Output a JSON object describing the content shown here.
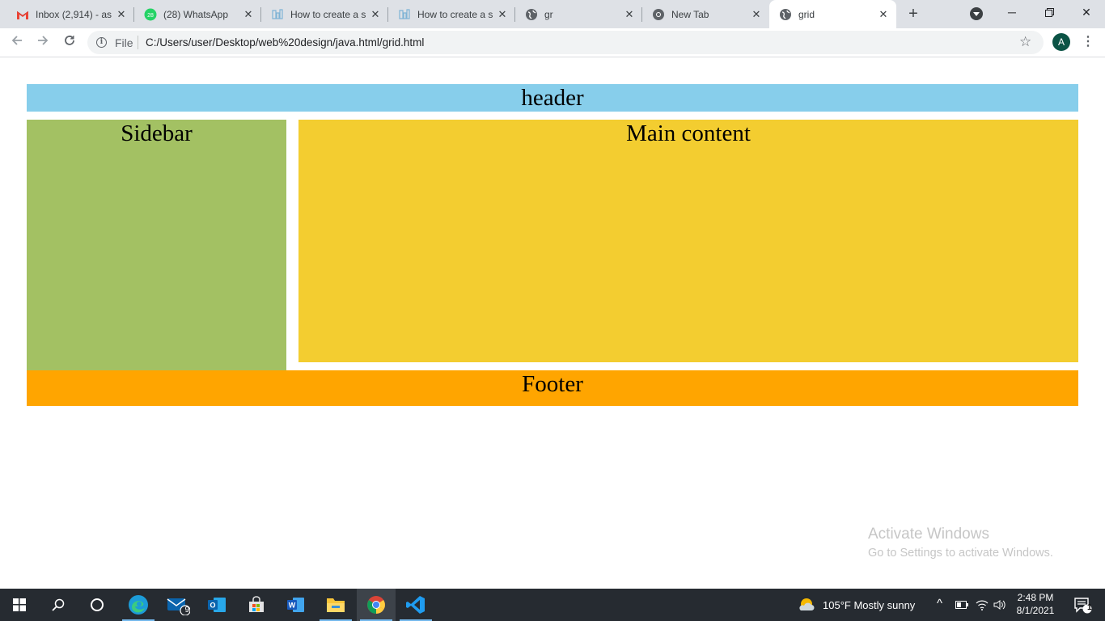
{
  "tabs": [
    {
      "title": "Inbox (2,914) - as",
      "icon": "gmail-icon"
    },
    {
      "title": "(28) WhatsApp",
      "icon": "whatsapp-icon",
      "badge": "28"
    },
    {
      "title": "How to create a s",
      "icon": "site-icon"
    },
    {
      "title": "How to create a s",
      "icon": "site-icon"
    },
    {
      "title": "gr",
      "icon": "globe-icon"
    },
    {
      "title": "New Tab",
      "icon": "chrome-icon"
    },
    {
      "title": "grid",
      "icon": "globe-icon",
      "active": true
    }
  ],
  "toolbar": {
    "file_label": "File",
    "url": "C:/Users/user/Desktop/web%20design/java.html/grid.html",
    "avatar_letter": "A"
  },
  "page": {
    "header": "header",
    "sidebar": "Sidebar",
    "main": "Main content",
    "footer": "Footer",
    "colors": {
      "header": "#87ceeb",
      "sidebar": "#a3c163",
      "main": "#f3cd30",
      "footer": "#ffa500"
    }
  },
  "watermark": {
    "title": "Activate Windows",
    "subtitle": "Go to Settings to activate Windows."
  },
  "taskbar": {
    "mail_badge": "9",
    "weather": "105°F  Mostly sunny",
    "time": "2:48 PM",
    "date": "8/1/2021",
    "notification_count": "1"
  }
}
